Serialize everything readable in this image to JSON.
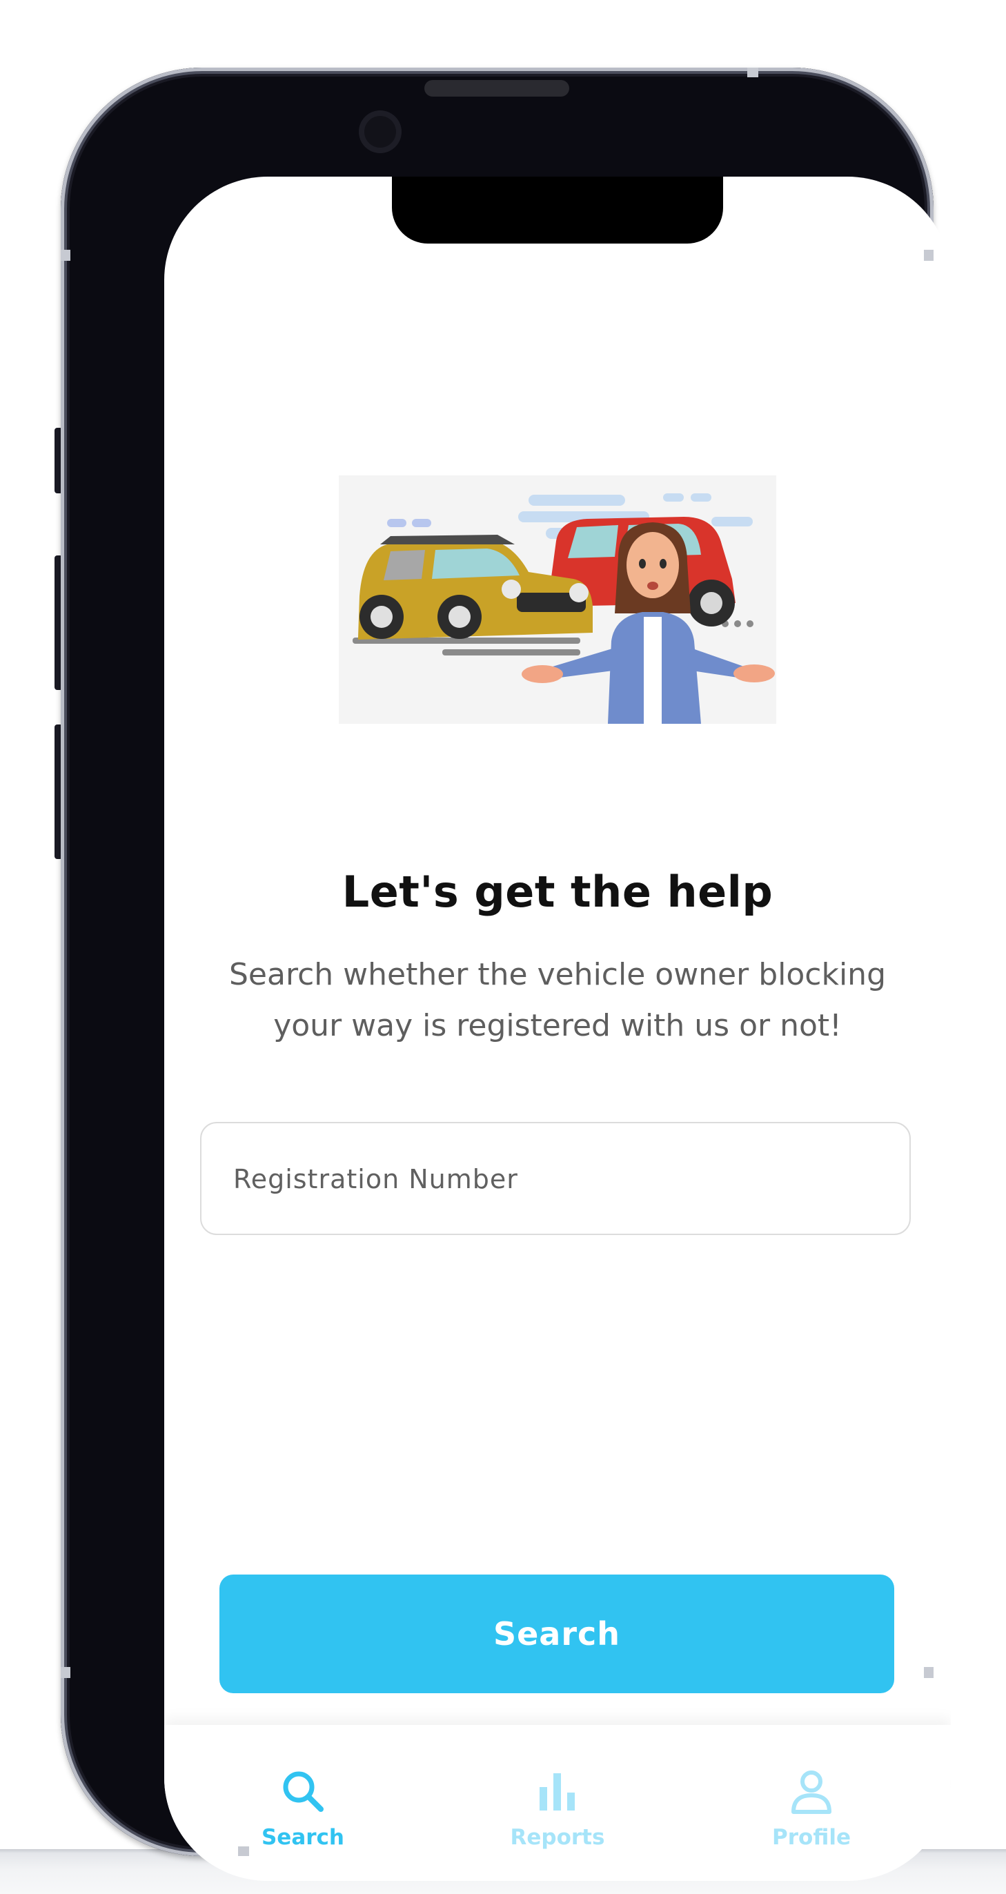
{
  "main": {
    "headline": "Let's get the help",
    "subtitle": "Search whether the vehicle owner blocking your way is registered with us or not!",
    "registration_input": {
      "value": "",
      "placeholder": "Registration Number"
    },
    "search_button_label": "Search"
  },
  "tabbar": {
    "active_index": 0,
    "items": [
      {
        "label": "Search",
        "icon": "search-icon"
      },
      {
        "label": "Reports",
        "icon": "bar-chart-icon"
      },
      {
        "label": "Profile",
        "icon": "user-icon"
      }
    ]
  },
  "colors": {
    "accent": "#31c3f1",
    "tab_active": "#31c3f1",
    "tab_inactive": "#a6e4f9",
    "headline": "#111111",
    "subtitle": "#5e5e5e"
  }
}
